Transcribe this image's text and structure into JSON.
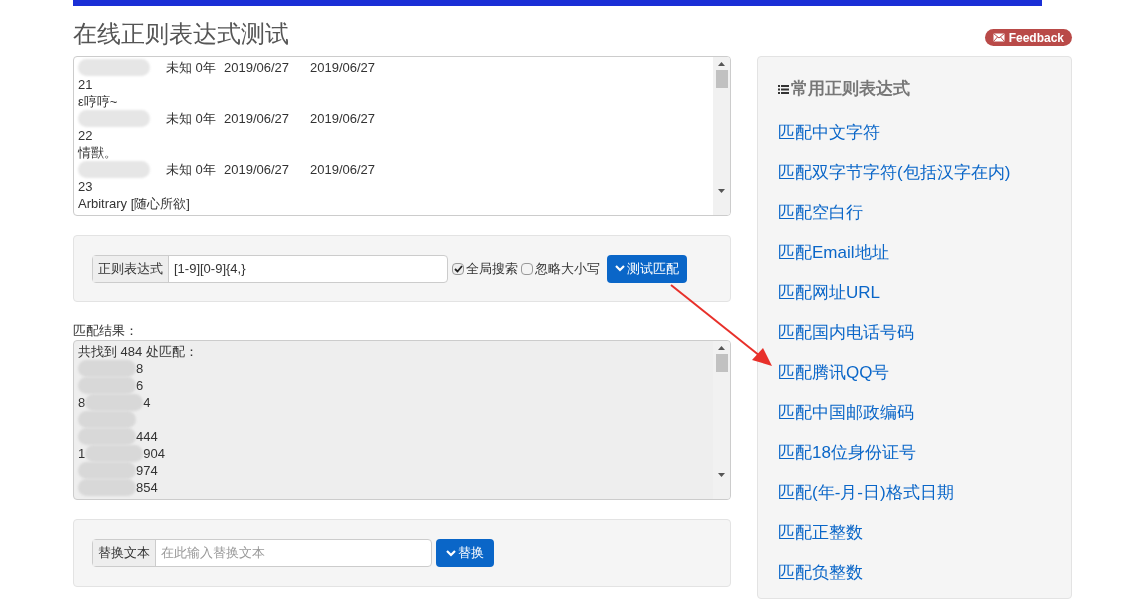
{
  "title": "在线正则表达式测试",
  "feedback": "Feedback",
  "source_lines": [
    {
      "kind": "record",
      "fields": [
        "未知 0年",
        "2019/06/27",
        "2019/06/27"
      ]
    },
    {
      "kind": "text",
      "text": "21"
    },
    {
      "kind": "text",
      "text": "ε哼哼~"
    },
    {
      "kind": "record",
      "fields": [
        "未知 0年",
        "2019/06/27",
        "2019/06/27"
      ]
    },
    {
      "kind": "text",
      "text": "22"
    },
    {
      "kind": "text",
      "text": "情獸。"
    },
    {
      "kind": "record",
      "fields": [
        "未知 0年",
        "2019/06/27",
        "2019/06/27"
      ]
    },
    {
      "kind": "text",
      "text": "23"
    },
    {
      "kind": "text",
      "text": "Arbitrary [随心所欲]"
    }
  ],
  "regex": {
    "label": "正则表达式",
    "value": "[1-9][0-9]{4,}"
  },
  "options": [
    {
      "label": "全局搜索",
      "checked": true
    },
    {
      "label": "忽略大小写",
      "checked": false
    }
  ],
  "test_button": "测试匹配",
  "result_label": "匹配结果：",
  "result_lines": [
    {
      "kind": "text",
      "text": "共找到 484 处匹配："
    },
    {
      "kind": "masked",
      "tail": "8"
    },
    {
      "kind": "masked",
      "tail": "6"
    },
    {
      "kind": "masked",
      "head": "8",
      "tail": "4"
    },
    {
      "kind": "masked"
    },
    {
      "kind": "masked",
      "tail": "444"
    },
    {
      "kind": "masked",
      "head": "1",
      "tail": "904"
    },
    {
      "kind": "masked",
      "tail": "974"
    },
    {
      "kind": "masked",
      "tail": "854"
    }
  ],
  "replace": {
    "label": "替换文本",
    "placeholder": "在此输入替换文本"
  },
  "replace_button": "替换",
  "sidebar": {
    "heading": "常用正则表达式",
    "links": [
      "匹配中文字符",
      "匹配双字节字符(包括汉字在内)",
      "匹配空白行",
      "匹配Email地址",
      "匹配网址URL",
      "匹配国内电话号码",
      "匹配腾讯QQ号",
      "匹配中国邮政编码",
      "匹配18位身份证号",
      "匹配(年-月-日)格式日期",
      "匹配正整数",
      "匹配负整数"
    ]
  }
}
